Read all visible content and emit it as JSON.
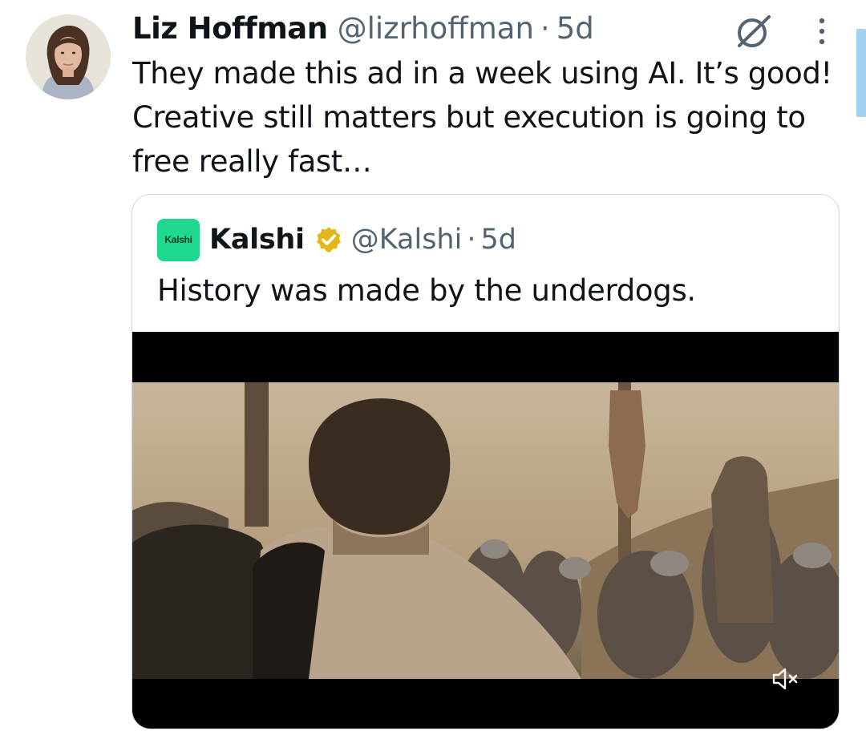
{
  "tweet": {
    "author_name": "Liz Hoffman",
    "author_handle": "@lizrhoffman",
    "separator": "·",
    "time": "5d",
    "text": "They made this ad in a week using AI. It’s good! Creative still matters but execution is going to free really fast…"
  },
  "quoted": {
    "logo_text": "Kalshi",
    "author_name": "Kalshi",
    "author_handle": "@Kalshi",
    "separator": "·",
    "time": "5d",
    "text": "History was made by the underdogs.",
    "verified_icon": "verified-badge-gold-icon"
  },
  "icons": {
    "grok": "grok-icon",
    "more": "more-vertical-icon",
    "mute": "volume-muted-icon"
  },
  "colors": {
    "text": "#0f1419",
    "secondary": "#536471",
    "border": "#cfd9de",
    "kalshi_green": "#1ed88e",
    "verified_gold": "#e2b719"
  }
}
